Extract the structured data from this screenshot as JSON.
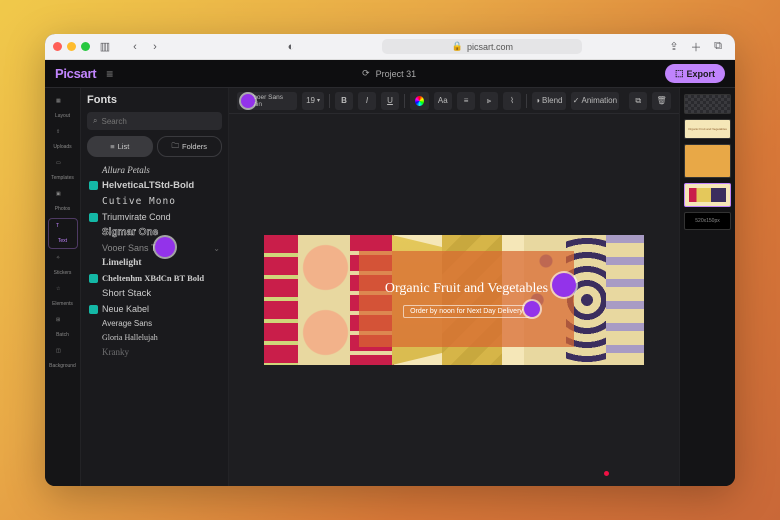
{
  "browser": {
    "url": "picsart.com"
  },
  "app": {
    "logo": "Picsart",
    "project_name": "Project 31",
    "export_label": "Export"
  },
  "rail": [
    {
      "id": "layout",
      "label": "Layout"
    },
    {
      "id": "uploads",
      "label": "Uploads"
    },
    {
      "id": "templates",
      "label": "Templates"
    },
    {
      "id": "photos",
      "label": "Photos"
    },
    {
      "id": "text",
      "label": "Text"
    },
    {
      "id": "stickers",
      "label": "Stickers"
    },
    {
      "id": "elements",
      "label": "Elements"
    },
    {
      "id": "batch",
      "label": "Batch"
    },
    {
      "id": "background",
      "label": "Background"
    }
  ],
  "panel": {
    "title": "Fonts",
    "search_placeholder": "Search",
    "tab_list": "List",
    "tab_folders": "Folders",
    "fonts": [
      {
        "name": "Allura Petals",
        "badge": false,
        "style": "italic 9px cursive"
      },
      {
        "name": "HelveticaLTStd-Bold",
        "badge": true,
        "style": "bold 9.5px sans-serif"
      },
      {
        "name": "Cutive Mono",
        "badge": false,
        "style": "9.5px monospace",
        "ls": "1px"
      },
      {
        "name": "Triumvirate Cond",
        "badge": true,
        "style": "9px sans-serif"
      },
      {
        "name": "Sigmar One",
        "badge": false,
        "style": "bold 10px sans-serif",
        "outline": true
      },
      {
        "name": "Vooer Sans Thin",
        "badge": false,
        "style": "300 9px sans-serif",
        "selected": true
      },
      {
        "name": "Limelight",
        "badge": false,
        "style": "bold 9.5px serif"
      },
      {
        "name": "Cheltenhm XBdCn BT Bold",
        "badge": true,
        "style": "bold 8.5px serif"
      },
      {
        "name": "Short Stack",
        "badge": false,
        "style": "9.5px sans-serif"
      },
      {
        "name": "Neue Kabel",
        "badge": true,
        "style": "9px sans-serif"
      },
      {
        "name": "Average Sans",
        "badge": false,
        "style": "8px sans-serif"
      },
      {
        "name": "Gloria Hallelujah",
        "badge": false,
        "style": "8px cursive"
      },
      {
        "name": "Kranky",
        "badge": false,
        "style": "9px serif",
        "dim": true
      }
    ]
  },
  "toolbar": {
    "font_name": "Vooer Sans Thin",
    "font_size": "19",
    "blend": "Blend",
    "animation": "Animation"
  },
  "canvas": {
    "headline": "Organic Fruit and Vegetables",
    "subline": "Order by noon for Next Day Delivery"
  },
  "thumbs": {
    "t2_label": "Organic Fruit and Vegetables",
    "size_label": "520x150px"
  }
}
